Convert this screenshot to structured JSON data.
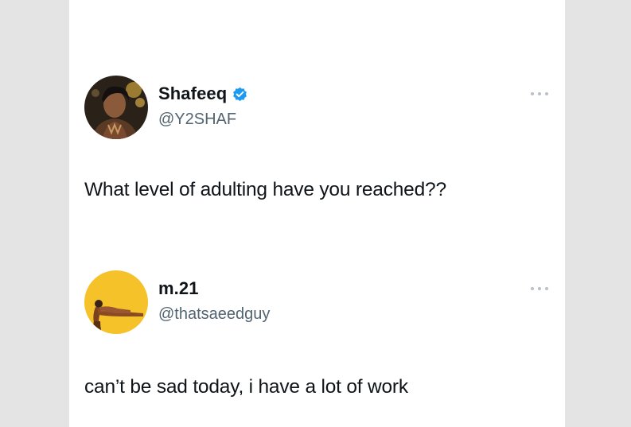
{
  "tweets": [
    {
      "display_name": "Shafeeq",
      "handle": "@Y2SHAF",
      "verified": true,
      "avatar_icon": "user-photo-avatar",
      "text": "What level of adulting have you reached??"
    },
    {
      "display_name": "m.21",
      "handle": "@thatsaeedguy",
      "verified": false,
      "avatar_icon": "reaching-figure-avatar",
      "text": "can’t be sad today, i have a lot of work"
    }
  ],
  "colors": {
    "background": "#e4e4e4",
    "card": "#ffffff",
    "text_primary": "#0f1419",
    "text_secondary": "#536471",
    "verified_blue": "#1d9bf0",
    "avatar_yellow": "#f6c22a"
  },
  "icons": {
    "verified": "verified-badge-icon",
    "more": "more-options-icon"
  }
}
